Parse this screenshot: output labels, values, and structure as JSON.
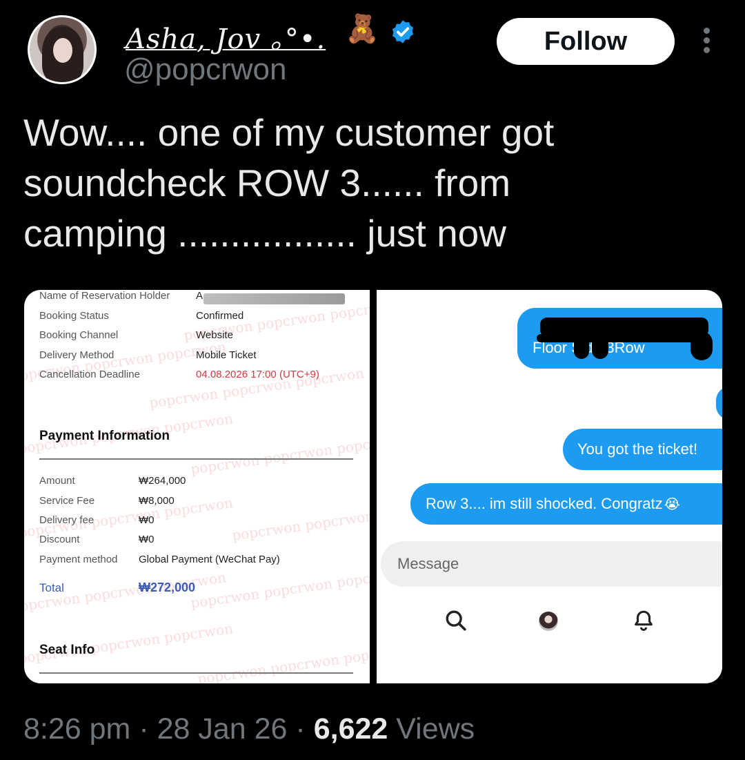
{
  "author": {
    "display_name": "Asha, Jov ｡°•. ",
    "handle": "@popcrwon",
    "emoji": "🧸",
    "verified_icon": "verified-badge-icon",
    "avatar_icon": "profile-avatar"
  },
  "actions": {
    "follow_label": "Follow",
    "more_icon": "more-options-icon"
  },
  "tweet": {
    "lines": [
      "Wow.... one of my customer got",
      "soundcheck ROW 3...... from",
      "camping ................. just now"
    ]
  },
  "receipt": {
    "reservation_rows": [
      {
        "label": "Name of Reservation Holder",
        "value": "A"
      },
      {
        "label": "Booking Status",
        "value": "Confirmed"
      },
      {
        "label": "Booking Channel",
        "value": "Website"
      },
      {
        "label": "Delivery Method",
        "value": "Mobile Ticket"
      },
      {
        "label": "Cancellation Deadline",
        "value": "04.08.2026 17:00 (UTC+9)"
      }
    ],
    "payment_title": "Payment Information",
    "payment_rows": [
      {
        "label": "Amount",
        "value": "₩264,000"
      },
      {
        "label": "Service Fee",
        "value": "₩8,000"
      },
      {
        "label": "Delivery fee",
        "value": "₩0"
      },
      {
        "label": "Discount",
        "value": "₩0"
      },
      {
        "label": "Payment method",
        "value": "Global Payment (WeChat Pay)"
      }
    ],
    "total_label": "Total",
    "total_value": "₩272,000",
    "seat_title": "Seat Info",
    "watermark": "popcrwon popcrwon popcrwon",
    "accent_red": "#d9363e",
    "accent_blue": "#3b5bb5"
  },
  "chat": {
    "bubble_1": "Floor  Side 3Row",
    "bubble_2": "You got the ticket!",
    "bubble_3": "Row 3.... im still shocked. Congratz",
    "bubble_3_emoji": "😭",
    "message_placeholder": "Message",
    "bubble_color": "#1d9bf0",
    "nav_icons": [
      "search-icon",
      "avatar",
      "bell-icon"
    ]
  },
  "footer": {
    "time": "8:26 pm",
    "sep1": " · ",
    "date": "28 Jan 26",
    "sep2": " · ",
    "views_count": "6,622",
    "views_label": " Views"
  }
}
